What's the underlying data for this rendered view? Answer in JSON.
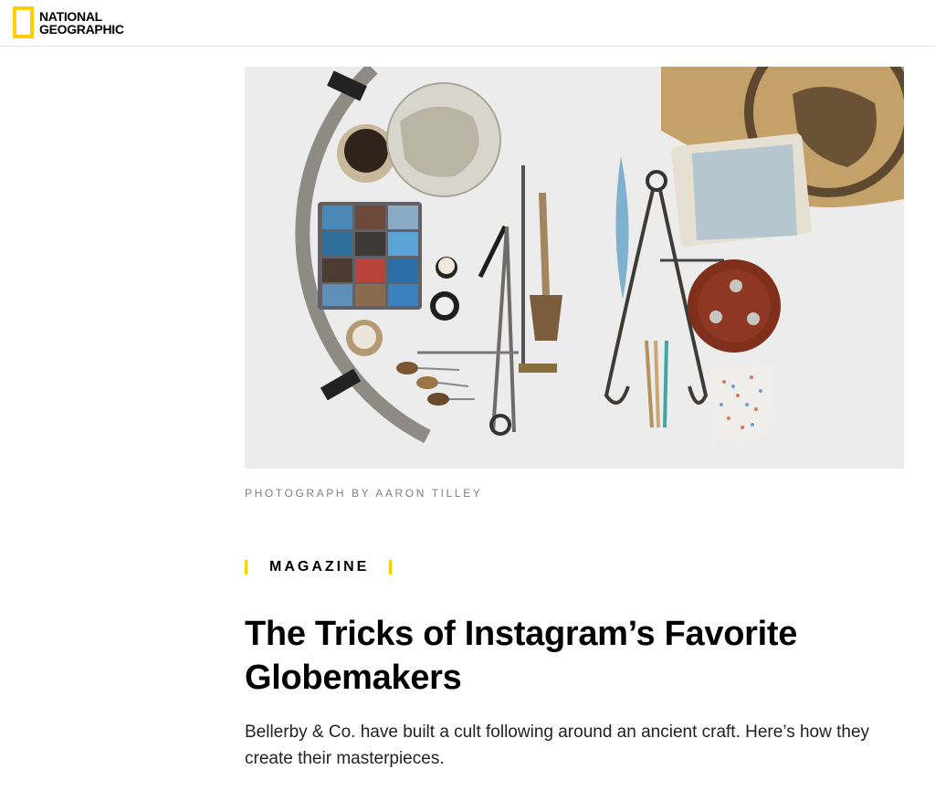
{
  "header": {
    "logo_line1": "NATIONAL",
    "logo_line2": "GEOGRAPHIC",
    "brand_color": "#FFCE00"
  },
  "hero": {
    "icon": "photo-still-life-globemaking-tools"
  },
  "credit": "PHOTOGRAPH BY AARON TILLEY",
  "article": {
    "section": "MAGAZINE",
    "title": "The Tricks of Instagram’s Favorite Globemakers",
    "dek": "Bellerby & Co. have built a cult following around an ancient craft. Here’s how they create their masterpieces."
  }
}
